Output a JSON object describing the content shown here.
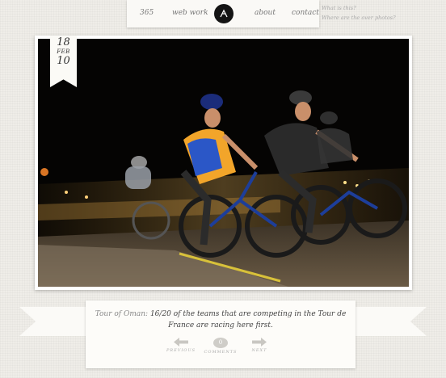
{
  "nav": {
    "items": [
      "365",
      "web work",
      "about",
      "contact"
    ],
    "side_links": [
      "What is this?",
      "Where are the over photos?"
    ]
  },
  "post": {
    "date": {
      "day": "18",
      "month": "FEB",
      "year": "10"
    },
    "caption": {
      "link": "Tour of Oman:",
      "text": " 16/20 of the teams that are competing in the Tour de France are racing here first."
    },
    "pager": {
      "previous": "PREVIOUS",
      "comments": "COMMENTS",
      "comment_count": "0",
      "next": "NEXT"
    }
  },
  "photo": {
    "subject": "cyclists racing at night"
  }
}
